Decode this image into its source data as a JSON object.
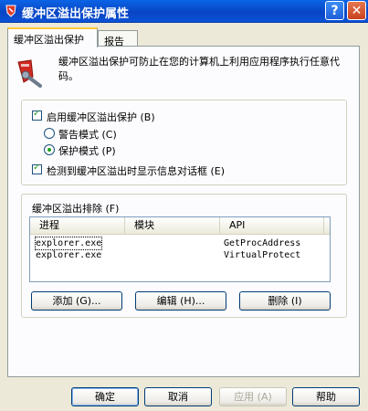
{
  "window": {
    "title": "缓冲区溢出保护属性",
    "help_button": "?",
    "close_button": "✕"
  },
  "tabs": [
    {
      "label": "缓冲区溢出保护",
      "active": true
    },
    {
      "label": "报告",
      "active": false
    }
  ],
  "description": "缓冲区溢出保护可防止在您的计算机上利用应用程序执行任意代码。",
  "options": {
    "enable_label": "启用缓冲区溢出保护 (B)",
    "enable_checked": true,
    "warn_mode_label": "警告模式 (C)",
    "protect_mode_label": "保护模式 (P)",
    "selected_mode": "protect",
    "show_dialog_label": "检测到缓冲区溢出时显示信息对话框 (E)",
    "show_dialog_checked": true
  },
  "exclusions": {
    "group_label": "缓冲区溢出排除 (F)",
    "columns": [
      "进程",
      "模块",
      "API"
    ],
    "rows": [
      {
        "process": "explorer.exe",
        "module": "",
        "api": "GetProcAddress",
        "selected": true
      },
      {
        "process": "explorer.exe",
        "module": "",
        "api": "VirtualProtect",
        "selected": false
      }
    ],
    "add_button": "添加 (G)...",
    "edit_button": "编辑 (H)...",
    "delete_button": "删除 (I)"
  },
  "footer": {
    "ok": "确定",
    "cancel": "取消",
    "apply": "应用 (A)",
    "help": "帮助"
  }
}
